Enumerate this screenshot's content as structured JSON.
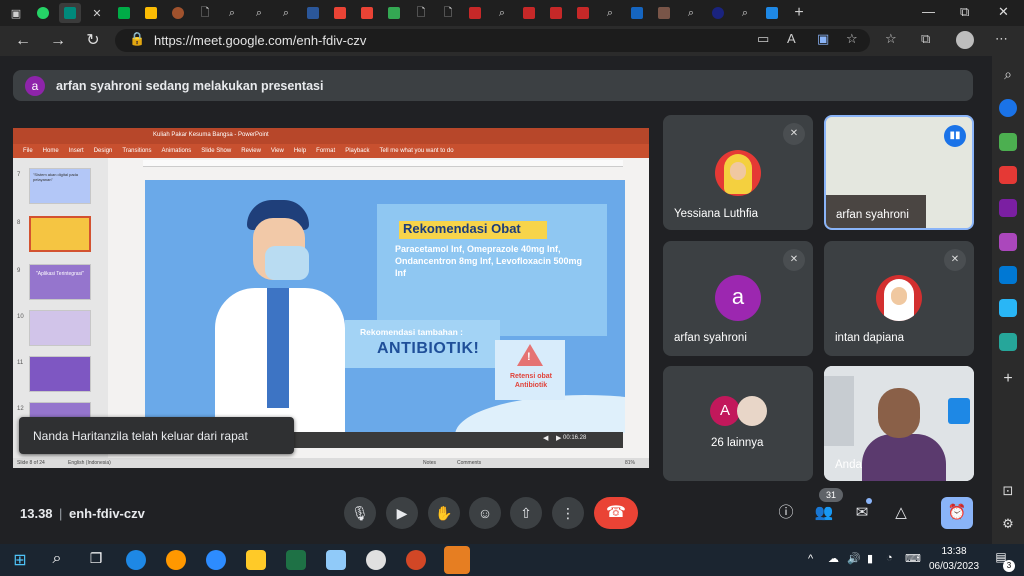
{
  "browser": {
    "url": "https://meet.google.com/enh-fdiv-czv",
    "win_restore": "⧉",
    "win_min": "—",
    "win_close": "✕"
  },
  "meet": {
    "presenter_banner": "arfan syahroni sedang melakukan presentasi",
    "presenter_initial": "a",
    "toast": "Nanda Haritanzila telah keluar dari rapat",
    "time": "13.38",
    "meeting_code": "enh-fdiv-czv",
    "participant_count": "31",
    "participants": [
      {
        "name": "Yessiana Luthfia",
        "muted": true
      },
      {
        "name": "arfan syahroni",
        "muted": false,
        "speaking": true
      },
      {
        "name": "arfan syahroni",
        "initial": "a",
        "muted": true
      },
      {
        "name": "intan dapiana",
        "muted": true
      },
      {
        "name": "26 lainnya",
        "initial": "A"
      },
      {
        "name": "Anda"
      }
    ],
    "accent": "#8ab4f8",
    "end_call_color": "#ea4335"
  },
  "slide": {
    "rec_title": "Rekomendasi Obat",
    "rec_body": "Paracetamol Inf, Omeprazole 40mg Inf, Ondancentron 8mg Inf, Levofloxacin 500mg Inf",
    "tambah_label": "Rekomendasi tambahan :",
    "tambah_value": "ANTIBIOTIK!",
    "retensi": "Retensi obat Antibiotik",
    "media_time": "00:16.28",
    "ppt_title": "Kuliah Pakar Kesuma Bangsa - PowerPoint",
    "ppt_menu": [
      "File",
      "Home",
      "Insert",
      "Design",
      "Transitions",
      "Animations",
      "Slide Show",
      "Review",
      "View",
      "Help",
      "Format",
      "Playback",
      "Tell me what you want to do"
    ],
    "thumbs": [
      {
        "num": "7",
        "text": "\"Sistem akan digital pada pelayanan\""
      },
      {
        "num": "8",
        "text": ""
      },
      {
        "num": "9",
        "text": "\"Aplikasi Terintegrasi\""
      },
      {
        "num": "10",
        "text": ""
      },
      {
        "num": "11",
        "text": ""
      },
      {
        "num": "12",
        "text": ""
      }
    ],
    "status_left": "Slide 8 of 24",
    "status_lang": "English (Indonesia)",
    "status_notes": "Notes",
    "status_comments": "Comments",
    "status_zoom": "81%"
  },
  "taskbar": {
    "time": "13:38",
    "date": "06/03/2023",
    "notif": "3"
  }
}
